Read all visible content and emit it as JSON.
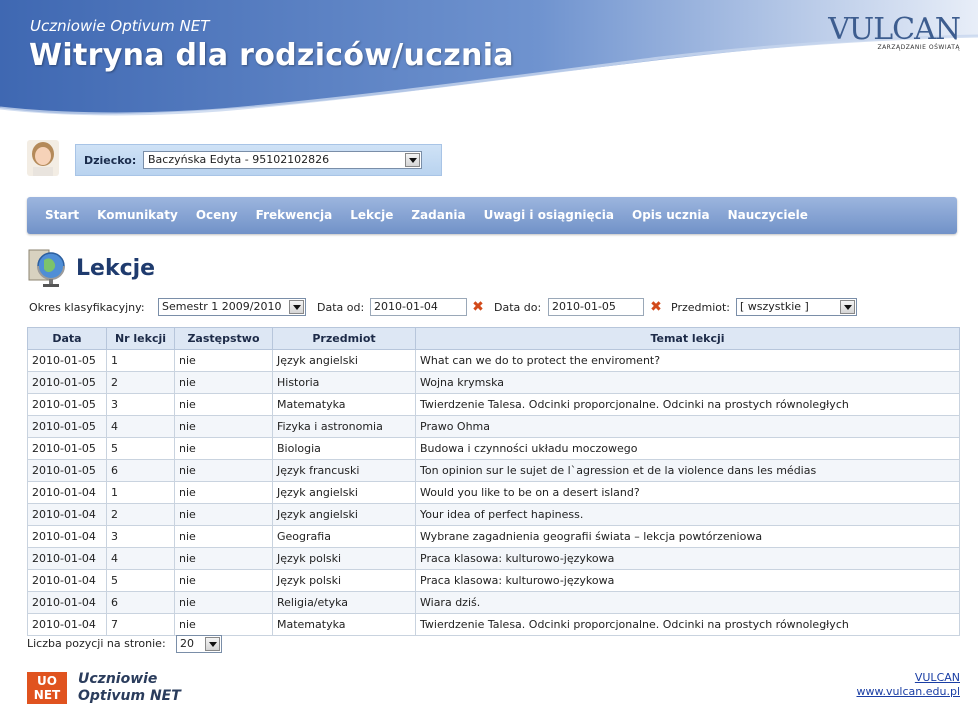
{
  "header": {
    "subtitle": "Uczniowie Optivum NET",
    "title": "Witryna dla rodziców/ucznia",
    "logo_brand": "VULCAN",
    "logo_tag": "ZARZĄDZANIE OŚWIATĄ"
  },
  "child": {
    "label": "Dziecko:",
    "selected": "Baczyńska Edyta - 95102102826"
  },
  "nav": {
    "items": [
      "Start",
      "Komunikaty",
      "Oceny",
      "Frekwencja",
      "Lekcje",
      "Zadania",
      "Uwagi i osiągnięcia",
      "Opis ucznia",
      "Nauczyciele"
    ]
  },
  "page": {
    "title": "Lekcje"
  },
  "filters": {
    "period_label": "Okres klasyfikacyjny:",
    "period_value": "Semestr 1 2009/2010",
    "from_label": "Data od:",
    "from_value": "2010-01-04",
    "to_label": "Data do:",
    "to_value": "2010-01-05",
    "subject_label": "Przedmiot:",
    "subject_value": "[ wszystkie ]"
  },
  "table": {
    "headers": [
      "Data",
      "Nr lekcji",
      "Zastępstwo",
      "Przedmiot",
      "Temat lekcji"
    ],
    "rows": [
      [
        "2010-01-05",
        "1",
        "nie",
        "Język angielski",
        "What can we do to protect the enviroment?"
      ],
      [
        "2010-01-05",
        "2",
        "nie",
        "Historia",
        "Wojna krymska"
      ],
      [
        "2010-01-05",
        "3",
        "nie",
        "Matematyka",
        "Twierdzenie Talesa. Odcinki proporcjonalne. Odcinki na prostych równoległych"
      ],
      [
        "2010-01-05",
        "4",
        "nie",
        "Fizyka i astronomia",
        "Prawo Ohma"
      ],
      [
        "2010-01-05",
        "5",
        "nie",
        "Biologia",
        "Budowa i czynności układu moczowego"
      ],
      [
        "2010-01-05",
        "6",
        "nie",
        "Język francuski",
        "Ton opinion sur le sujet de l`agression et de la violence dans les médias"
      ],
      [
        "2010-01-04",
        "1",
        "nie",
        "Język angielski",
        "Would you like to be on a desert island?"
      ],
      [
        "2010-01-04",
        "2",
        "nie",
        "Język angielski",
        "Your idea of perfect hapiness."
      ],
      [
        "2010-01-04",
        "3",
        "nie",
        "Geografia",
        "Wybrane zagadnienia geografii świata – lekcja powtórzeniowa"
      ],
      [
        "2010-01-04",
        "4",
        "nie",
        "Język polski",
        "Praca klasowa: kulturowo-językowa"
      ],
      [
        "2010-01-04",
        "5",
        "nie",
        "Język polski",
        "Praca klasowa: kulturowo-językowa"
      ],
      [
        "2010-01-04",
        "6",
        "nie",
        "Religia/etyka",
        "Wiara dziś."
      ],
      [
        "2010-01-04",
        "7",
        "nie",
        "Matematyka",
        "Twierdzenie Talesa. Odcinki proporcjonalne. Odcinki na prostych równoległych"
      ]
    ]
  },
  "pagination": {
    "label": "Liczba pozycji na stronie:",
    "value": "20"
  },
  "footer": {
    "logo_line1": "UO",
    "logo_line2": "NET",
    "product_line1": "Uczniowie",
    "product_line2": "Optivum NET",
    "link1": "VULCAN",
    "link2": "www.vulcan.edu.pl"
  },
  "colors": {
    "nav_bg": "#7f9fd1",
    "title_blue": "#1f3b6e",
    "clear_icon": "#d24a1a",
    "footer_logo": "#e0531f"
  }
}
